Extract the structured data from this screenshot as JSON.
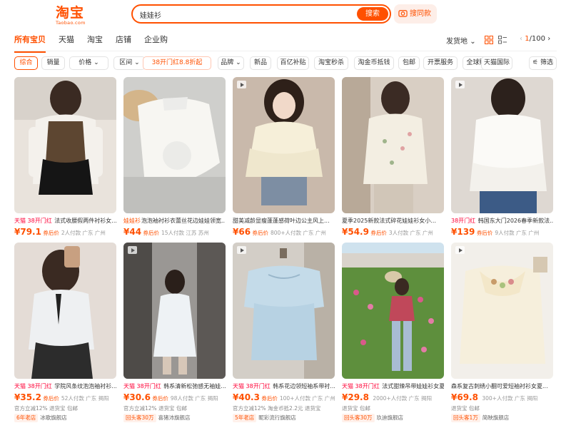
{
  "logo": {
    "cn": "淘宝",
    "en": "Taobao.com"
  },
  "search": {
    "query": "娃娃衫",
    "button": "搜索",
    "image_search": "搜同款"
  },
  "tabs": [
    "所有宝贝",
    "天猫",
    "淘宝",
    "店铺",
    "企业购"
  ],
  "sort": {
    "ship_from": "发货地",
    "page_current": "1",
    "page_total": "/100"
  },
  "filters": [
    "综合",
    "销量",
    "价格",
    "区间",
    "38开门红8.8折起",
    "品牌",
    "新品",
    "百亿补贴",
    "淘宝秒杀",
    "淘金币抵钱",
    "包邮",
    "开票服务",
    "全球购",
    "天猫国际",
    "筛选"
  ],
  "products": [
    {
      "tag1": "天猫 38开门红",
      "tag2": "",
      "title": "法式收腰假两件衬衫女...",
      "price": "79.1",
      "price_label": "券后价",
      "sales": "2人付款",
      "location": "广东 广州",
      "store_badge": "",
      "store": "",
      "video": false
    },
    {
      "tag1": "",
      "tag2": "娃娃衫",
      "title": "泡泡袖衬衫衣蕾丝花边娃娃领宽...",
      "price": "44",
      "price_label": "券后价",
      "sales": "15人付款",
      "location": "江苏 苏州",
      "store_badge": "",
      "store": "",
      "video": false
    },
    {
      "tag1": "",
      "tag2": "",
      "title": "甜美减龄显瘦蓬蓬感荷叶边公主风上...",
      "price": "66",
      "price_label": "券后价",
      "sales": "800+人付款",
      "location": "广东 广州",
      "store_badge": "",
      "store": "",
      "video": true
    },
    {
      "tag1": "",
      "tag2": "",
      "title": "夏季2025新款法式碎花娃娃衫女小...",
      "price": "54.9",
      "price_label": "券后价",
      "sales": "3人付款",
      "location": "广东 广州",
      "store_badge": "",
      "store": "",
      "video": false
    },
    {
      "tag1": "38开门红",
      "tag2": "",
      "title": "韩国东大门2026春季新款法...",
      "price": "139",
      "price_label": "券后价",
      "sales": "9人付款",
      "location": "广东 广州",
      "store_badge": "",
      "store": "",
      "video": true
    },
    {
      "tag1": "天猫 38开门红",
      "tag2": "",
      "title": "学院风条纹泡泡袖衬衫...",
      "price": "35.2",
      "price_label": "券后价",
      "sales": "52人付款",
      "location": "广东 揭阳",
      "store_badge": "6年老店",
      "store": "冰歌旗舰店",
      "extra": "官方立减12% 退货宝 包邮",
      "video": false
    },
    {
      "tag1": "天猫 38开门红",
      "tag2": "",
      "title": "韩系清新松弛感无袖娃...",
      "price": "30.6",
      "price_label": "券后价",
      "sales": "98人付款",
      "location": "广东 揭阳",
      "store_badge": "回头客30万",
      "store": "喜猪沛旗舰店",
      "extra": "官方立减12% 退货宝 包邮",
      "video": true
    },
    {
      "tag1": "天猫 38开门红",
      "tag2": "",
      "title": "韩系花边领短袖系带衬...",
      "price": "40.3",
      "price_label": "券后价",
      "sales": "100+人付款",
      "location": "广东 广州",
      "store_badge": "5年老店",
      "store": "昵彩流行旗舰店",
      "extra": "官方立减12% 淘金币抵2.2元 退货宝",
      "video": true
    },
    {
      "tag1": "天猫 38开门红",
      "tag2": "",
      "title": "法式甜辣吊带娃娃衫女夏季202...",
      "price": "29.8",
      "price_label": "",
      "sales": "2000+人付款",
      "location": "广东 揭阳",
      "store_badge": "回头客30万",
      "store": "玖迪旗舰店",
      "extra": "退货宝 包邮",
      "video": false
    },
    {
      "tag1": "",
      "tag2": "",
      "title": "森系复古刺绣小翻可爱短袖衬衫女夏...",
      "price": "69.8",
      "price_label": "",
      "sales": "300+人付款",
      "location": "广东 揭阳",
      "store_badge": "回头客1万",
      "store": "简映旗舰店",
      "extra": "退货宝 包邮",
      "video": true
    }
  ],
  "colors": {
    "accent": "#ff5000",
    "tmall": "#ff0036"
  }
}
